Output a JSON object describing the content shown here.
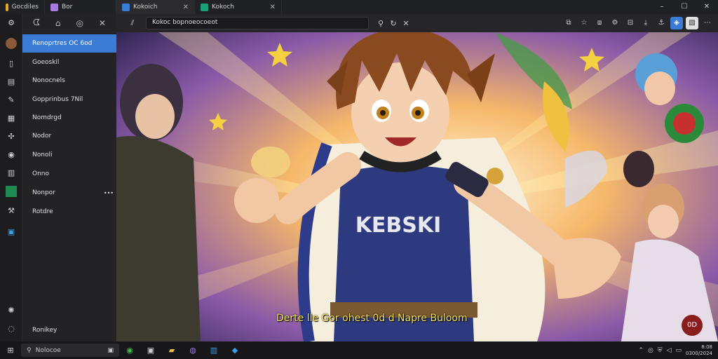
{
  "tabs": [
    {
      "label": "Gocdiles",
      "color": "#e5a823"
    },
    {
      "label": "Bor",
      "color": "#a57be0"
    },
    {
      "label": "Kokoich",
      "color": "#3a7bd5"
    },
    {
      "label": "Kokoch",
      "color": "#19a079"
    }
  ],
  "window_controls": {
    "minimize": "–",
    "maximize": "☐",
    "close": "✕"
  },
  "sidebar": {
    "items": [
      {
        "label": "Renoprtres OC 6od"
      },
      {
        "label": "Goeoskil"
      },
      {
        "label": "Nonocnels"
      },
      {
        "label": "Gopprinbus 7Nil"
      },
      {
        "label": "Nomdrgd"
      },
      {
        "label": "Nodor"
      },
      {
        "label": "Nonoli"
      },
      {
        "label": "Onno"
      },
      {
        "label": "Nonpor"
      },
      {
        "label": "Rotdre"
      }
    ],
    "more": "•••",
    "footer": "Ronikey"
  },
  "urlbar": {
    "value": "Kokoc bopnoeocoeot"
  },
  "subtitle": "Derte lle Gor ohest 0d d Napre Buloom",
  "badge": "0D",
  "artwork_text": "KEBSKI",
  "taskbar": {
    "search": "Nolocoe",
    "clock_time": "8:08",
    "clock_date": "0300/2024"
  },
  "colors": {
    "accent": "#3a7bd5",
    "subtitle": "#f6e45a"
  }
}
